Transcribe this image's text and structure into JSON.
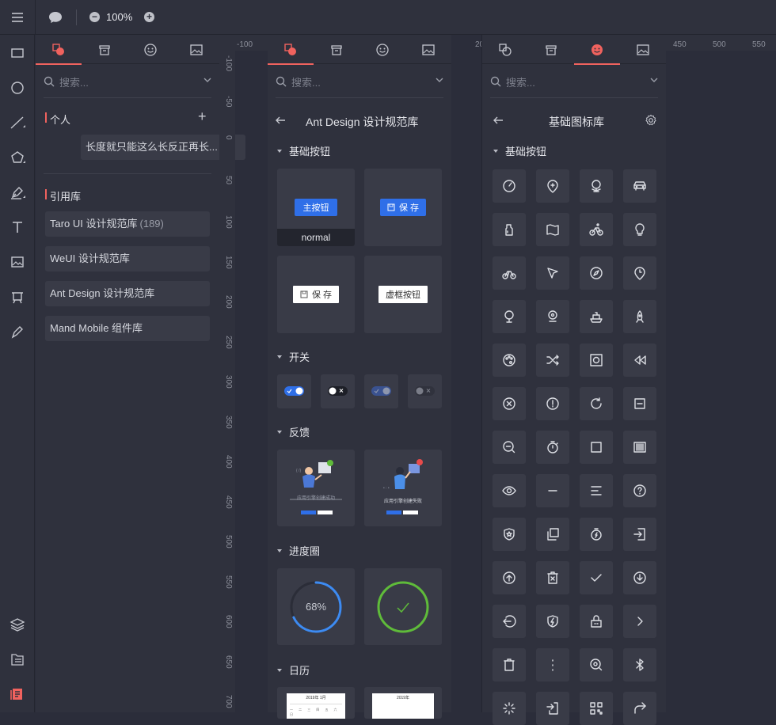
{
  "toolbar": {
    "zoom_minus": "−",
    "zoom_value": "100%",
    "zoom_plus": "+"
  },
  "left_panel": {
    "search_placeholder": "搜索...",
    "personal_title": "个人",
    "add_label": "+",
    "personal_item": "长度就只能这么长反正再长...",
    "ref_title": "引用库",
    "libraries": [
      {
        "name": "Taro UI 设计规范库",
        "count": "(189)"
      },
      {
        "name": "WeUI 设计规范库",
        "count": ""
      },
      {
        "name": "Ant Design 设计规范库",
        "count": ""
      },
      {
        "name": "Mand Mobile 组件库",
        "count": ""
      }
    ]
  },
  "ruler_v": [
    "-100",
    "-50",
    "0",
    "50",
    "100",
    "150",
    "200",
    "250",
    "300",
    "350",
    "400",
    "450",
    "500",
    "550",
    "600",
    "650",
    "700"
  ],
  "ruler_h1": [
    "-100"
  ],
  "ruler_h2": [
    "20"
  ],
  "ruler_h3": [
    "450",
    "500",
    "550"
  ],
  "mid_panel": {
    "search_placeholder": "搜索...",
    "title": "Ant Design 设计规范库",
    "groups": {
      "buttons": "基础按钮",
      "switch": "开关",
      "feedback": "反馈",
      "progress": "进度圈",
      "calendar": "日历"
    },
    "btn_primary": "主按钮",
    "btn_save": "保 存",
    "btn_save2": "保 存",
    "btn_dashed": "虚框按钮",
    "normal_label": "normal",
    "progress_value": "68%",
    "progress_fraction": 0.68,
    "feedback_success": "应用引擎创建成功",
    "feedback_fail": "应用引擎创建失败",
    "calendar_title_1": "2019年 1月",
    "calendar_title_2": "2019年"
  },
  "right_panel": {
    "search_placeholder": "搜索...",
    "title": "基础图标库",
    "group": "基础按钮",
    "icons": [
      "dashboard-icon",
      "location-add-icon",
      "globe-icon",
      "car-icon",
      "bottle-icon",
      "map-icon",
      "bicycle-icon",
      "bulb-icon",
      "bicycle-2-icon",
      "cursor-icon",
      "compass-icon",
      "time-icon",
      "pin-icon",
      "location-icon",
      "ship-icon",
      "rocket-icon",
      "palette-icon",
      "shuffle-icon",
      "camera-icon",
      "rewind-icon",
      "close-circle-icon",
      "alert-circle-icon",
      "reload-icon",
      "minus-square-icon",
      "zoom-out-icon",
      "stopwatch-icon",
      "square-icon",
      "barcode-icon",
      "eye-icon",
      "minus-icon",
      "align-icon",
      "question-icon",
      "shield-star-icon",
      "copy-icon",
      "timer-icon",
      "login-icon",
      "upload-circle-icon",
      "delete-box-icon",
      "check-icon",
      "download-circle-icon",
      "logout-icon",
      "shield-bolt-icon",
      "lock-icon",
      "chevron-right-icon",
      "trash-icon",
      "more-vertical-icon",
      "search-zoom-icon",
      "bluetooth-icon",
      "loading-icon",
      "import-icon",
      "qrcode-icon",
      "redo-icon"
    ]
  },
  "colors": {
    "accent": "#f0625e",
    "blue": "#2f6fe8",
    "green": "#5fbb3a"
  }
}
